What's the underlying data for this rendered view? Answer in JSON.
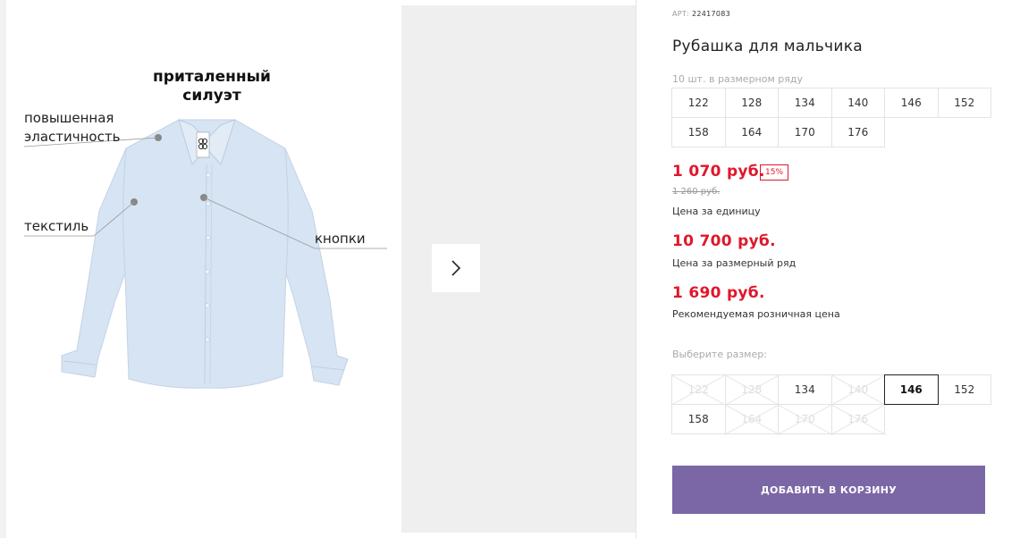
{
  "product": {
    "article_label": "АРТ:",
    "article": "22417083",
    "title": "Рубашка для мальчика",
    "range_note": "10 шт. в размерном ряду"
  },
  "size_range": [
    "122",
    "128",
    "134",
    "140",
    "146",
    "152",
    "158",
    "164",
    "170",
    "176"
  ],
  "prices": {
    "unit_price": "1 070 руб.",
    "discount": "15%",
    "old_price": "1 260 руб.",
    "unit_caption": "Цена за единицу",
    "range_price": "10 700 руб.",
    "range_caption": "Цена за размерный ряд",
    "retail_price": "1 690 руб.",
    "retail_caption": "Рекомендуемая розничная цена"
  },
  "size_select": {
    "label": "Выберите размер:",
    "options": [
      {
        "size": "122",
        "available": false
      },
      {
        "size": "128",
        "available": false
      },
      {
        "size": "134",
        "available": true
      },
      {
        "size": "140",
        "available": false
      },
      {
        "size": "146",
        "available": true,
        "selected": true
      },
      {
        "size": "152",
        "available": true
      },
      {
        "size": "158",
        "available": true
      },
      {
        "size": "164",
        "available": false
      },
      {
        "size": "170",
        "available": false
      },
      {
        "size": "176",
        "available": false
      }
    ]
  },
  "add_to_cart": "ДОБАВИТЬ В КОРЗИНУ",
  "photo": {
    "fit_label": "приталенный силуэт",
    "features": {
      "elasticity": "повышенная эластичность",
      "textile": "текстиль",
      "buttons": "кнопки"
    }
  },
  "icons": {
    "next": "chevron-right-icon"
  },
  "colors": {
    "price_red": "#e0172b",
    "button_purple": "#7b67a6",
    "shirt_blue": "#d6e4f3"
  }
}
